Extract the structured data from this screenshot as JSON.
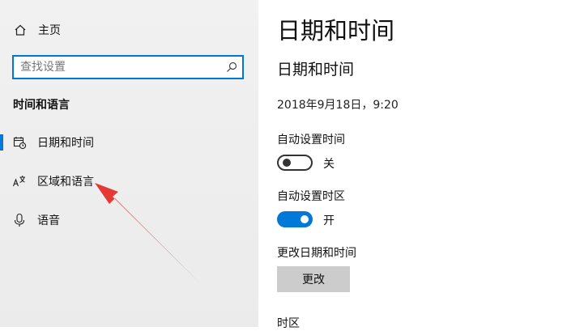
{
  "sidebar": {
    "home_label": "主页",
    "search_placeholder": "查找设置",
    "section_title": "时间和语言",
    "items": [
      {
        "label": "日期和时间",
        "icon": "calendar-clock-icon",
        "selected": true
      },
      {
        "label": "区域和语言",
        "icon": "language-icon",
        "selected": false
      },
      {
        "label": "语音",
        "icon": "microphone-icon",
        "selected": false
      }
    ]
  },
  "main": {
    "page_title": "日期和时间",
    "section_heading": "日期和时间",
    "current_datetime": "2018年9月18日，9:20",
    "auto_time": {
      "label": "自动设置时间",
      "state": "关",
      "on": false
    },
    "auto_timezone": {
      "label": "自动设置时区",
      "state": "开",
      "on": true
    },
    "change": {
      "label": "更改日期和时间",
      "button": "更改"
    },
    "timezone_label": "时区"
  },
  "colors": {
    "accent": "#0078d7",
    "annotation_arrow": "#e53935"
  }
}
